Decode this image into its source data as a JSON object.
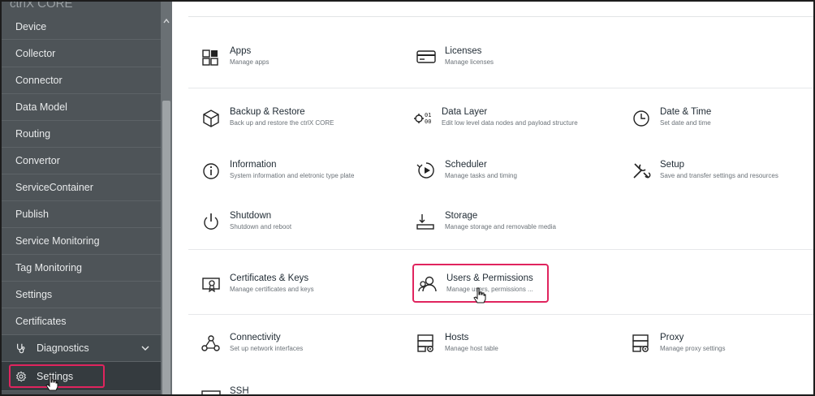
{
  "sidebar": {
    "brand": "ctrlX CORE",
    "items": [
      {
        "label": "Device"
      },
      {
        "label": "Collector"
      },
      {
        "label": "Connector"
      },
      {
        "label": "Data Model"
      },
      {
        "label": "Routing"
      },
      {
        "label": "Convertor"
      },
      {
        "label": "ServiceContainer"
      },
      {
        "label": "Publish"
      },
      {
        "label": "Service Monitoring"
      },
      {
        "label": "Tag Monitoring"
      },
      {
        "label": "Settings"
      },
      {
        "label": "Certificates"
      }
    ],
    "diagnostics": {
      "label": "Diagnostics",
      "icon": "diagnostics-icon"
    },
    "settings": {
      "label": "Settings",
      "icon": "gear-icon",
      "highlight_color": "#e0245e"
    }
  },
  "main": {
    "tiles": [
      {
        "title": "Apps",
        "desc": "Manage apps",
        "icon": "apps-icon"
      },
      {
        "title": "Licenses",
        "desc": "Manage licenses",
        "icon": "license-icon"
      },
      {
        "title": "Backup & Restore",
        "desc": "Back up and restore the ctrlX CORE",
        "icon": "backup-icon"
      },
      {
        "title": "Data Layer",
        "desc": "Edit low level data nodes and payload structure",
        "icon": "data-layer-icon"
      },
      {
        "title": "Date & Time",
        "desc": "Set date and time",
        "icon": "clock-icon"
      },
      {
        "title": "Information",
        "desc": "System information and eletronic type plate",
        "icon": "info-icon"
      },
      {
        "title": "Scheduler",
        "desc": "Manage tasks and timing",
        "icon": "scheduler-icon"
      },
      {
        "title": "Setup",
        "desc": "Save and transfer settings and resources",
        "icon": "setup-icon"
      },
      {
        "title": "Shutdown",
        "desc": "Shutdown and reboot",
        "icon": "power-icon"
      },
      {
        "title": "Storage",
        "desc": "Manage storage and removable media",
        "icon": "storage-icon"
      },
      {
        "title": "Certificates & Keys",
        "desc": "Manage certificates and keys",
        "icon": "certificate-icon"
      },
      {
        "title": "Users & Permissions",
        "desc": "Manage users, permissions ...",
        "icon": "users-icon"
      },
      {
        "title": "Connectivity",
        "desc": "Set up network interfaces",
        "icon": "connectivity-icon"
      },
      {
        "title": "Hosts",
        "desc": "Manage host table",
        "icon": "hosts-icon"
      },
      {
        "title": "Proxy",
        "desc": "Manage proxy settings",
        "icon": "proxy-icon"
      },
      {
        "title": "SSH",
        "desc": "",
        "icon": "ssh-icon"
      }
    ],
    "highlight_color": "#e0245e"
  }
}
